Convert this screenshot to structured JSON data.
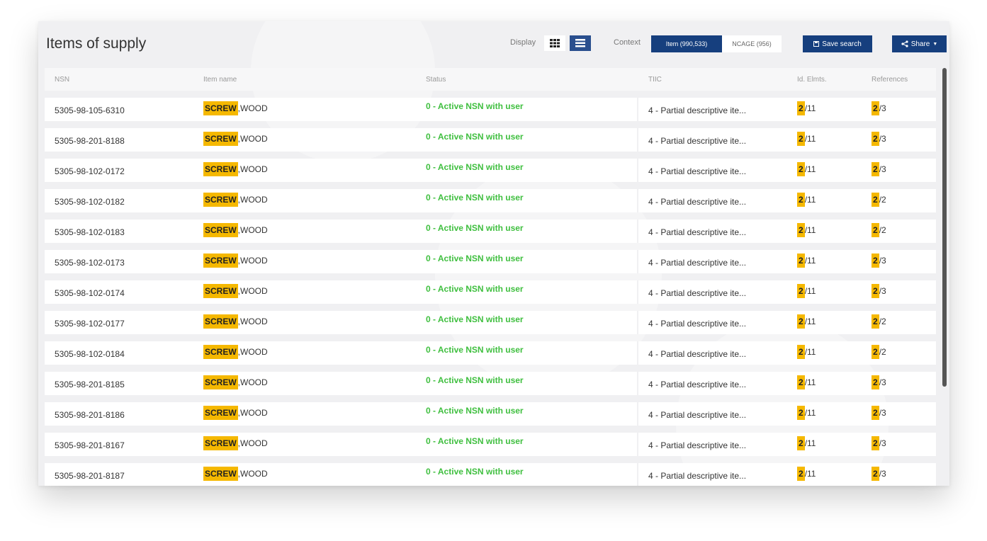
{
  "header": {
    "title": "Items of supply",
    "display_label": "Display",
    "context_label": "Context",
    "context_active": "Item (990,533)",
    "context_inactive": "NCAGE (956)",
    "save_label": "Save search",
    "share_label": "Share"
  },
  "columns": [
    "NSN",
    "Item name",
    "Status",
    "TIIC",
    "Id. Elmts.",
    "References"
  ],
  "rows": [
    {
      "nsn": "5305-98-105-6310",
      "name_hl": "SCREW",
      "name_rest": ",WOOD",
      "status": "0 - Active NSN with user",
      "tiic": "4 - Partial descriptive ite...",
      "ids_hl": "2",
      "ids_rest": "/11",
      "refs_hl": "2",
      "refs_rest": "/3"
    },
    {
      "nsn": "5305-98-201-8188",
      "name_hl": "SCREW",
      "name_rest": ",WOOD",
      "status": "0 - Active NSN with user",
      "tiic": "4 - Partial descriptive ite...",
      "ids_hl": "2",
      "ids_rest": "/11",
      "refs_hl": "2",
      "refs_rest": "/3"
    },
    {
      "nsn": "5305-98-102-0172",
      "name_hl": "SCREW",
      "name_rest": ",WOOD",
      "status": "0 - Active NSN with user",
      "tiic": "4 - Partial descriptive ite...",
      "ids_hl": "2",
      "ids_rest": "/11",
      "refs_hl": "2",
      "refs_rest": "/3"
    },
    {
      "nsn": "5305-98-102-0182",
      "name_hl": "SCREW",
      "name_rest": ",WOOD",
      "status": "0 - Active NSN with user",
      "tiic": "4 - Partial descriptive ite...",
      "ids_hl": "2",
      "ids_rest": "/11",
      "refs_hl": "2",
      "refs_rest": "/2"
    },
    {
      "nsn": "5305-98-102-0183",
      "name_hl": "SCREW",
      "name_rest": ",WOOD",
      "status": "0 - Active NSN with user",
      "tiic": "4 - Partial descriptive ite...",
      "ids_hl": "2",
      "ids_rest": "/11",
      "refs_hl": "2",
      "refs_rest": "/2"
    },
    {
      "nsn": "5305-98-102-0173",
      "name_hl": "SCREW",
      "name_rest": ",WOOD",
      "status": "0 - Active NSN with user",
      "tiic": "4 - Partial descriptive ite...",
      "ids_hl": "2",
      "ids_rest": "/11",
      "refs_hl": "2",
      "refs_rest": "/3"
    },
    {
      "nsn": "5305-98-102-0174",
      "name_hl": "SCREW",
      "name_rest": ",WOOD",
      "status": "0 - Active NSN with user",
      "tiic": "4 - Partial descriptive ite...",
      "ids_hl": "2",
      "ids_rest": "/11",
      "refs_hl": "2",
      "refs_rest": "/3"
    },
    {
      "nsn": "5305-98-102-0177",
      "name_hl": "SCREW",
      "name_rest": ",WOOD",
      "status": "0 - Active NSN with user",
      "tiic": "4 - Partial descriptive ite...",
      "ids_hl": "2",
      "ids_rest": "/11",
      "refs_hl": "2",
      "refs_rest": "/2"
    },
    {
      "nsn": "5305-98-102-0184",
      "name_hl": "SCREW",
      "name_rest": ",WOOD",
      "status": "0 - Active NSN with user",
      "tiic": "4 - Partial descriptive ite...",
      "ids_hl": "2",
      "ids_rest": "/11",
      "refs_hl": "2",
      "refs_rest": "/2"
    },
    {
      "nsn": "5305-98-201-8185",
      "name_hl": "SCREW",
      "name_rest": ",WOOD",
      "status": "0 - Active NSN with user",
      "tiic": "4 - Partial descriptive ite...",
      "ids_hl": "2",
      "ids_rest": "/11",
      "refs_hl": "2",
      "refs_rest": "/3"
    },
    {
      "nsn": "5305-98-201-8186",
      "name_hl": "SCREW",
      "name_rest": ",WOOD",
      "status": "0 - Active NSN with user",
      "tiic": "4 - Partial descriptive ite...",
      "ids_hl": "2",
      "ids_rest": "/11",
      "refs_hl": "2",
      "refs_rest": "/3"
    },
    {
      "nsn": "5305-98-201-8167",
      "name_hl": "SCREW",
      "name_rest": ",WOOD",
      "status": "0 - Active NSN with user",
      "tiic": "4 - Partial descriptive ite...",
      "ids_hl": "2",
      "ids_rest": "/11",
      "refs_hl": "2",
      "refs_rest": "/3"
    },
    {
      "nsn": "5305-98-201-8187",
      "name_hl": "SCREW",
      "name_rest": ",WOOD",
      "status": "0 - Active NSN with user",
      "tiic": "4 - Partial descriptive ite...",
      "ids_hl": "2",
      "ids_rest": "/11",
      "refs_hl": "2",
      "refs_rest": "/3"
    }
  ],
  "colors": {
    "accent": "#163f7e",
    "highlight": "#f5b800",
    "status_green": "#3fbf3f"
  },
  "icons": {
    "grid": "grid-view-icon",
    "list": "list-view-icon",
    "save": "save-icon",
    "share": "share-icon",
    "caret": "caret-down-icon"
  }
}
